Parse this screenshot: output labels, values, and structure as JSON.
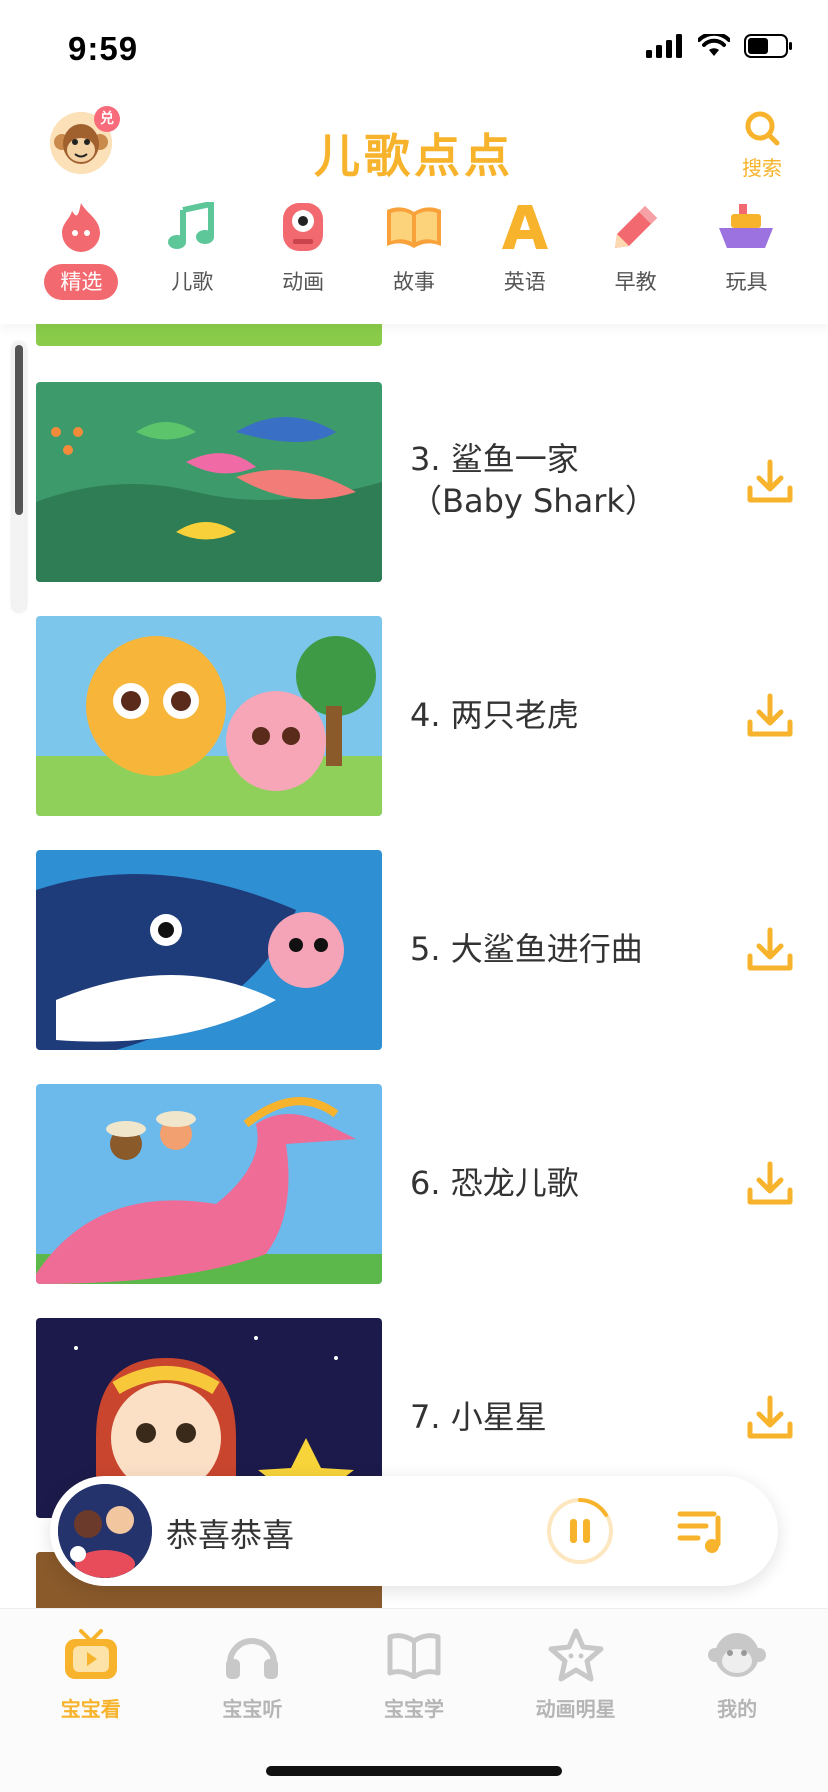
{
  "status": {
    "time": "9:59"
  },
  "header": {
    "title": "儿歌点点",
    "avatar_badge": "兑",
    "search_label": "搜索"
  },
  "categories": [
    {
      "label": "精选",
      "icon": "fire-icon",
      "active": true
    },
    {
      "label": "儿歌",
      "icon": "music-note-icon",
      "active": false
    },
    {
      "label": "动画",
      "icon": "eye-monster-icon",
      "active": false
    },
    {
      "label": "故事",
      "icon": "book-icon",
      "active": false
    },
    {
      "label": "英语",
      "icon": "letter-a-icon",
      "active": false
    },
    {
      "label": "早教",
      "icon": "pencil-icon",
      "active": false
    },
    {
      "label": "玩具",
      "icon": "boat-toy-icon",
      "active": false
    }
  ],
  "videos": [
    {
      "title": "3. 鲨鱼一家\n（Baby Shark）",
      "line1": "3. 鲨鱼一家",
      "line2": "（Baby Shark）"
    },
    {
      "title": "4. 两只老虎"
    },
    {
      "title": "5. 大鲨鱼进行曲"
    },
    {
      "title": "6. 恐龙儿歌"
    },
    {
      "title": "7. 小星星"
    }
  ],
  "player": {
    "title": "恭喜恭喜",
    "state": "playing"
  },
  "tabs": [
    {
      "label": "宝宝看",
      "icon": "tv-icon",
      "active": true
    },
    {
      "label": "宝宝听",
      "icon": "headphones-icon",
      "active": false
    },
    {
      "label": "宝宝学",
      "icon": "open-book-icon",
      "active": false
    },
    {
      "label": "动画明星",
      "icon": "star-icon",
      "active": false
    },
    {
      "label": "我的",
      "icon": "monkey-face-icon",
      "active": false
    }
  ],
  "colors": {
    "accent": "#f7b32b",
    "active_category": "#f2696f"
  }
}
